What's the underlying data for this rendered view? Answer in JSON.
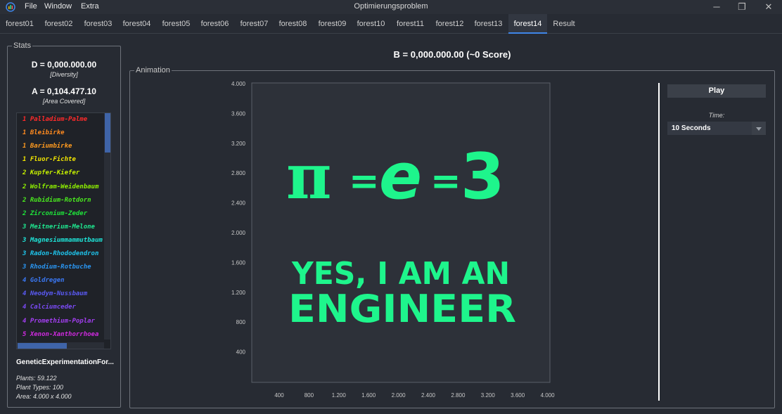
{
  "window": {
    "title": "Optimierungsproblem",
    "menu": [
      "File",
      "Window",
      "Extra"
    ],
    "controls": {
      "minimize": "─",
      "maximize": "❐",
      "close": "✕"
    }
  },
  "tabs": [
    "forest01",
    "forest02",
    "forest03",
    "forest04",
    "forest05",
    "forest06",
    "forest07",
    "forest08",
    "forest09",
    "forest10",
    "forest11",
    "forest12",
    "forest13",
    "forest14",
    "Result"
  ],
  "active_tab": "forest14",
  "stats": {
    "group_title": "Stats",
    "diversity_value": "D = 0,000.000.00",
    "diversity_label": "[Diversity]",
    "area_value": "A = 0,104.477.10",
    "area_label": "[Area Covered]",
    "plants": [
      {
        "text": "1 Palladium-Palme",
        "color": "#ff2a2a"
      },
      {
        "text": "1 Bleibirke",
        "color": "#ff8a1f"
      },
      {
        "text": "1 Bariumbirke",
        "color": "#ff9a1f"
      },
      {
        "text": "1 Fluor-Fichte",
        "color": "#f2e600"
      },
      {
        "text": "2 Kupfer-Kiefer",
        "color": "#c5f000"
      },
      {
        "text": "2 Wolfram-Weidenbaum",
        "color": "#8ef000"
      },
      {
        "text": "2 Rubidium-Rotdorn",
        "color": "#49ea1e"
      },
      {
        "text": "2 Zirconium-Zeder",
        "color": "#1ee63a"
      },
      {
        "text": "3 Meitnerium-Melone",
        "color": "#1ee890"
      },
      {
        "text": "3 Magnesiummammutbaum",
        "color": "#1ee4d8"
      },
      {
        "text": "3 Radon-Rhododendron",
        "color": "#1ec4ec"
      },
      {
        "text": "3 Rhodium-Rotbuche",
        "color": "#2a96f2"
      },
      {
        "text": "4 Goldregen",
        "color": "#3a78f4"
      },
      {
        "text": "4 Neodym-Nussbaum",
        "color": "#5a5af4"
      },
      {
        "text": "4 Calciumceder",
        "color": "#7a4af4"
      },
      {
        "text": "4 Promethium-Poplar",
        "color": "#a23ef0"
      },
      {
        "text": "5 Xenon-Xanthorrhoea",
        "color": "#d02ae0"
      }
    ],
    "experiment_title": "GeneticExperimentationFor...",
    "plants_count": "Plants: 59.122",
    "plant_types": "Plant Types: 100",
    "area": "Area: 4.000 x 4.000"
  },
  "score_text": "B = 0,000.000.00 (~0 Score)",
  "animation": {
    "group_title": "Animation",
    "x_ticks": [
      "400",
      "800",
      "1.200",
      "1.600",
      "2.000",
      "2.400",
      "2.800",
      "3.200",
      "3.600",
      "4.000"
    ],
    "y_ticks": [
      "4.000",
      "3.600",
      "3.200",
      "2.800",
      "2.400",
      "2.000",
      "1.600",
      "1.200",
      "800",
      "400"
    ],
    "overlay": {
      "formula": [
        "π",
        "=",
        "e",
        "=",
        "3"
      ],
      "line1": "YES, I AM AN",
      "line2": "ENGINEER",
      "color": "#1ef58c"
    }
  },
  "controls": {
    "play_label": "Play",
    "time_label": "Time:",
    "time_value": "10 Seconds"
  },
  "colors": {
    "background": "#272b33",
    "accent": "#3f86e8",
    "plot_green": "#1ef58c"
  }
}
